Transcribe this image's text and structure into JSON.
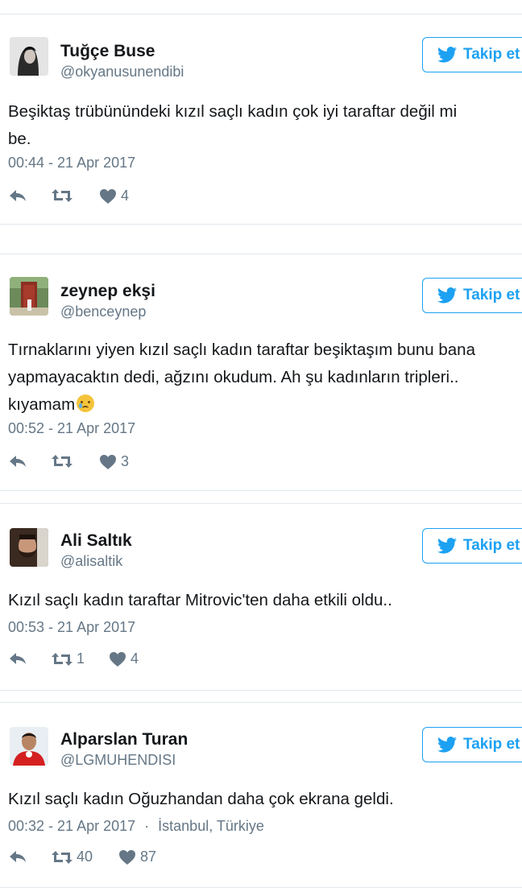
{
  "follow_label": "Takip et",
  "tweets": [
    {
      "name": "Tuğçe Buse",
      "handle": "@okyanusunendibi",
      "text_lines": [
        "Beşiktaş trübünündeki kızıl saçlı kadın çok iyi taraftar değil mi",
        "be."
      ],
      "timestamp": "00:44 - 21 Apr 2017",
      "location": "",
      "retweets": "",
      "likes": "4"
    },
    {
      "name": "zeynep ekşi",
      "handle": "@benceynep",
      "text_lines": [
        "Tırnaklarını yiyen kızıl saçlı kadın taraftar beşiktaşım bunu bana",
        "yapmayacaktın dedi, ağzını okudum. Ah şu kadınların tripleri..",
        "kıyamam"
      ],
      "emoji": "crying-face",
      "timestamp": "00:52 - 21 Apr 2017",
      "location": "",
      "retweets": "",
      "likes": "3"
    },
    {
      "name": "Ali Saltık",
      "handle": "@alisaltik",
      "text_lines": [
        "Kızıl saçlı kadın taraftar Mitrovic'ten daha etkili oldu.."
      ],
      "timestamp": "00:53 - 21 Apr 2017",
      "location": "",
      "retweets": "1",
      "likes": "4"
    },
    {
      "name": "Alparslan Turan",
      "handle": "@LGMUHENDISI",
      "text_lines": [
        "Kızıl saçlı kadın Oğuzhandan daha çok ekrana geldi."
      ],
      "timestamp": "00:32 - 21 Apr 2017",
      "location": "İstanbul, Türkiye",
      "retweets": "40",
      "likes": "87"
    }
  ],
  "colors": {
    "accent": "#1da1f2",
    "muted": "#657786",
    "border": "#e1e8ed"
  }
}
